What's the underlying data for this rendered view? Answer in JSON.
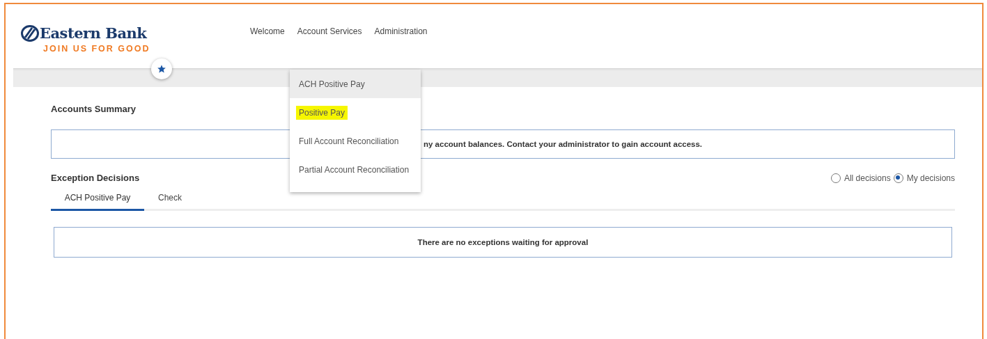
{
  "logo": {
    "name": "Eastern Bank",
    "tagline": "JOIN US FOR GOOD"
  },
  "nav": [
    {
      "label": "Welcome"
    },
    {
      "label": "Account Services"
    },
    {
      "label": "Administration"
    }
  ],
  "dropdown": [
    {
      "label": "ACH Positive Pay",
      "hovered": true,
      "highlighted": false
    },
    {
      "label": "Positive Pay",
      "hovered": false,
      "highlighted": true
    },
    {
      "label": "Full Account Reconciliation",
      "hovered": false,
      "highlighted": false
    },
    {
      "label": "Partial Account Reconciliation",
      "hovered": false,
      "highlighted": false
    }
  ],
  "accounts_summary": {
    "title": "Accounts Summary",
    "message": "ny account balances. Contact your administrator to gain account access."
  },
  "exception_decisions": {
    "title": "Exception Decisions",
    "filters": [
      {
        "label": "All decisions",
        "selected": false
      },
      {
        "label": "My decisions",
        "selected": true
      }
    ],
    "tabs": [
      {
        "label": "ACH Positive Pay",
        "selected": true
      },
      {
        "label": "Check",
        "selected": false
      }
    ],
    "message": "There are no exceptions waiting for approval"
  }
}
